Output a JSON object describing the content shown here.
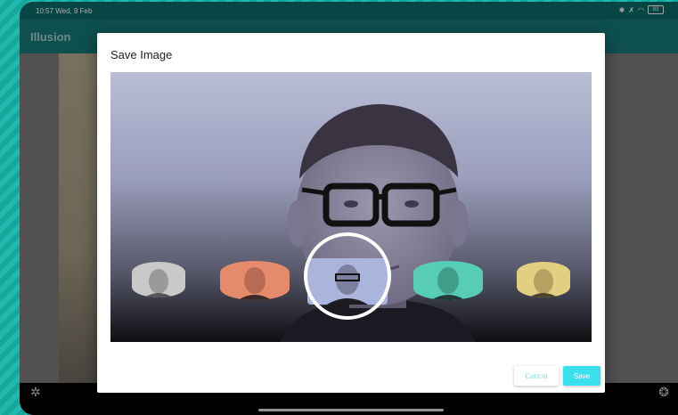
{
  "statusbar": {
    "time": "10:57  Wed, 9 Feb",
    "battery": "93"
  },
  "app": {
    "title": "Illusion"
  },
  "dialog": {
    "title": "Save Image",
    "cancel_label": "Cancel",
    "save_label": "Save",
    "filters": [
      {
        "name": "grayscale",
        "color": "#c9c9c9"
      },
      {
        "name": "warm-red",
        "color": "#e58b6b"
      },
      {
        "name": "blue",
        "color": "#aab4dc"
      },
      {
        "name": "teal",
        "color": "#57cdb6"
      },
      {
        "name": "yellow",
        "color": "#e2cf82"
      }
    ],
    "selected_filter": "blue"
  },
  "icons": {
    "settings": "gear-icon",
    "camera": "aperture-icon"
  }
}
